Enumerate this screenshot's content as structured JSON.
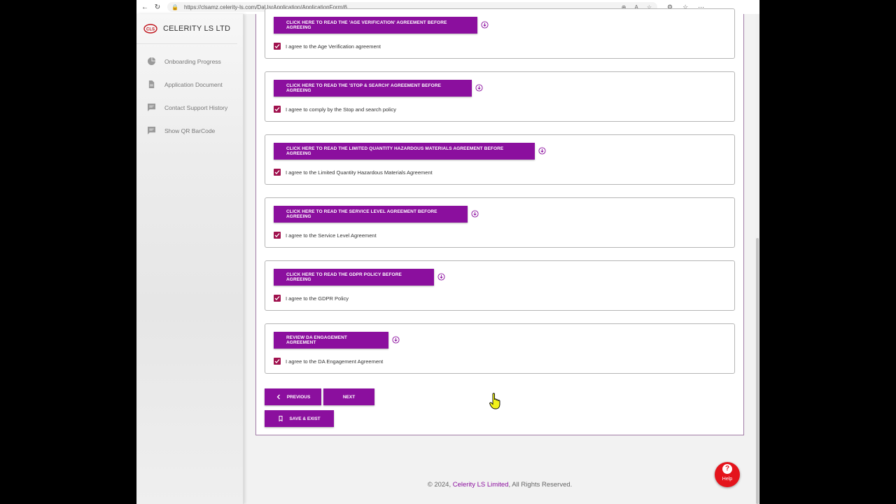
{
  "browser": {
    "url": "https://clsamz.celerity-ls.com/DaUsrApplication/ApplicationForm/6"
  },
  "sidebar": {
    "brand": "CELERITY LS LTD",
    "items": [
      {
        "label": "Onboarding Progress",
        "icon": "pie-chart-icon"
      },
      {
        "label": "Application Document",
        "icon": "document-icon"
      },
      {
        "label": "Contact Support History",
        "icon": "chat-icon"
      },
      {
        "label": "Show QR BarCode",
        "icon": "chat-icon"
      }
    ]
  },
  "agreements": [
    {
      "button": "CLICK HERE TO READ THE 'AGE VERIFICATION' AGREEMENT BEFORE AGREEING",
      "checkbox": "I agree to the Age Verification agreement"
    },
    {
      "button": "CLICK HERE TO READ THE 'STOP & SEARCH' AGREEMENT BEFORE AGREEING",
      "checkbox": "I agree to comply by the Stop and search policy"
    },
    {
      "button": "CLICK HERE TO READ THE LIMITED QUANTITY HAZARDOUS MATERIALS AGREEMENT BEFORE AGREEING",
      "checkbox": "I agree to the Limited Quantity Hazardous Materials Agreement"
    },
    {
      "button": "CLICK HERE TO READ THE SERVICE LEVEL AGREEMENT BEFORE AGREEING",
      "checkbox": "I agree to the Service Level Agreement"
    },
    {
      "button": "CLICK HERE TO READ THE GDPR POLICY BEFORE AGREEING",
      "checkbox": "I agree to the GDPR Policy"
    },
    {
      "button": "REVIEW DA ENGAGEMENT AGREEMENT",
      "checkbox": "I agree to the DA Engagement Agreement"
    }
  ],
  "nav": {
    "previous": "PREVIOUS",
    "next": "NEXT",
    "save": "SAVE & EXIST"
  },
  "footer": {
    "prefix": "© 2024, ",
    "link": "Celerity LS Limited",
    "suffix": ", All Rights Reserved."
  },
  "help": {
    "label": "Help",
    "glyph": "?"
  },
  "colors": {
    "accent": "#8b0f9e",
    "checkbox": "#a0124e",
    "help": "#e4141c"
  }
}
